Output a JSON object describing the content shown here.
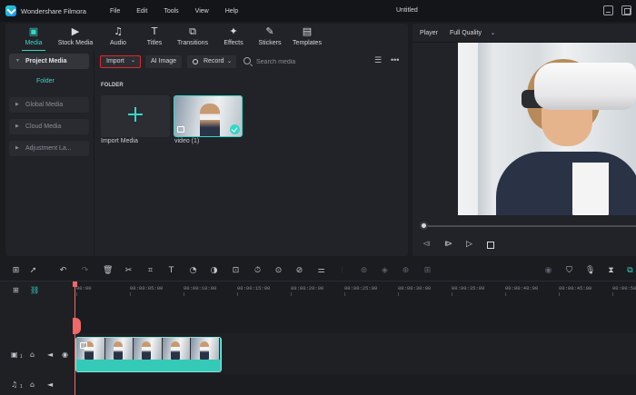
{
  "app": {
    "name": "Wondershare Filmora",
    "document_title": "Untitled",
    "menu": [
      "File",
      "Edit",
      "Tools",
      "View",
      "Help"
    ]
  },
  "media_tabs": [
    {
      "label": "Media",
      "icon": "media-icon",
      "active": true
    },
    {
      "label": "Stock Media",
      "icon": "stock-media-icon"
    },
    {
      "label": "Audio",
      "icon": "music-note-icon"
    },
    {
      "label": "Titles",
      "icon": "text-t-icon"
    },
    {
      "label": "Transitions",
      "icon": "transitions-icon"
    },
    {
      "label": "Effects",
      "icon": "sparkle-icon"
    },
    {
      "label": "Stickers",
      "icon": "sticker-icon"
    },
    {
      "label": "Templates",
      "icon": "templates-icon"
    }
  ],
  "sidebar": {
    "project_media": "Project Media",
    "folder": "Folder",
    "global_media": "Global Media",
    "cloud_media": "Cloud Media",
    "adjustment_layer": "Adjustment La..."
  },
  "media_toolbar": {
    "import_label": "Import",
    "ai_image_label": "AI Image",
    "record_label": "Record",
    "search_placeholder": "Search media"
  },
  "media_area": {
    "section_label": "FOLDER",
    "items": [
      {
        "label": "Import Media",
        "type": "import-placeholder"
      },
      {
        "label": "video (1)",
        "type": "video",
        "selected": true
      }
    ]
  },
  "player": {
    "label": "Player",
    "quality": "Full Quality",
    "progress": 0.0
  },
  "timeline": {
    "ruler_labels": [
      "00:00",
      "00:00:05:00",
      "00:00:10:00",
      "00:00:15:00",
      "00:00:20:00",
      "00:00:25:00",
      "00:00:30:00",
      "00:00:35:00",
      "00:00:40:00",
      "00:00:45:00",
      "00:00:50:00"
    ],
    "video_track_number": "1",
    "audio_track_number": "1",
    "clip_frame_count": 5
  },
  "colors": {
    "accent": "#35d7c8",
    "highlight_border": "#e02a2a",
    "playhead": "#f06868",
    "panel_bg": "#222328"
  }
}
